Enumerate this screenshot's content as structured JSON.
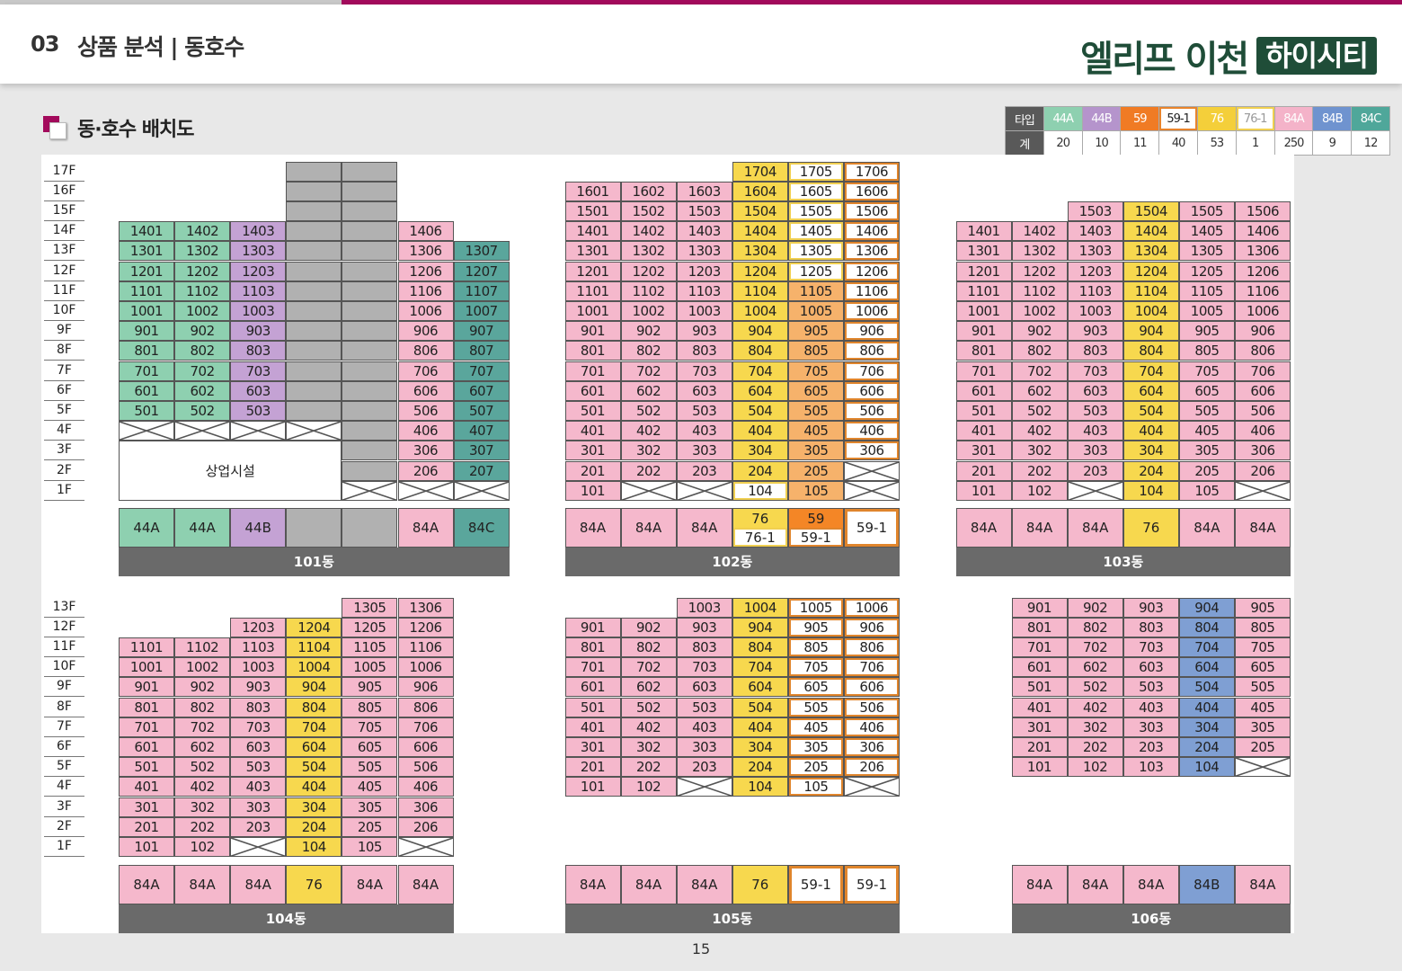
{
  "header": {
    "section_number": "03",
    "section_title": "상품 분석 | 동호수",
    "brand_main": "엘리프 이천",
    "brand_sub": "하이시티"
  },
  "sub_heading": "동·호수 배치도",
  "page_number": "15",
  "colors": {
    "44A": "#8ed0b0",
    "44B": "#c4a2d4",
    "59": "#f48626",
    "59-1": "#ffffff",
    "76": "#f7d84e",
    "76-1": "#ffffff",
    "84A": "#f5b8cc",
    "84B": "#7f9fd3",
    "84C": "#5aa69c",
    "gray": "#b1b1b1",
    "o59": "#f6b26b",
    "outline_59_1": "#e0852c",
    "outline_76_1": "#f0cf50"
  },
  "legend": {
    "row_headers": [
      "타입",
      "계"
    ],
    "types": [
      {
        "name": "44A",
        "count": "20",
        "color": "#8ed0b0",
        "text": "#ffffff",
        "outline": ""
      },
      {
        "name": "44B",
        "count": "10",
        "color": "#b594cc",
        "text": "#ffffff",
        "outline": ""
      },
      {
        "name": "59",
        "count": "11",
        "color": "#f07b24",
        "text": "#ffffff",
        "outline": ""
      },
      {
        "name": "59-1",
        "count": "40",
        "color": "#ffffff",
        "text": "#222222",
        "outline": "#e8842c"
      },
      {
        "name": "76",
        "count": "53",
        "color": "#f4cf3a",
        "text": "#ffffff",
        "outline": ""
      },
      {
        "name": "76-1",
        "count": "1",
        "color": "#ffffff",
        "text": "#999999",
        "outline": "#f0cf50"
      },
      {
        "name": "84A",
        "count": "250",
        "color": "#f4b3c9",
        "text": "#ffffff",
        "outline": ""
      },
      {
        "name": "84B",
        "count": "9",
        "color": "#6f93cf",
        "text": "#ffffff",
        "outline": ""
      },
      {
        "name": "84C",
        "count": "12",
        "color": "#4fa79a",
        "text": "#ffffff",
        "outline": ""
      }
    ]
  },
  "buildings": [
    {
      "name": "101동",
      "floors": [
        "17F",
        "16F",
        "15F",
        "14F",
        "13F",
        "12F",
        "11F",
        "10F",
        "9F",
        "8F",
        "7F",
        "6F",
        "5F",
        "4F",
        "3F",
        "2F",
        "1F"
      ],
      "commercial_label": "상업시설",
      "types": [
        {
          "label": "44A",
          "color": "44A"
        },
        {
          "label": "44A",
          "color": "44A"
        },
        {
          "label": "44B",
          "color": "44B"
        },
        {
          "label": "",
          "color": "gray"
        },
        {
          "label": "",
          "color": "gray"
        },
        {
          "label": "84A",
          "color": "84A"
        },
        {
          "label": "84C",
          "color": "84C"
        }
      ]
    },
    {
      "name": "102동",
      "floors": [],
      "types": [
        {
          "label": "84A",
          "color": "84A"
        },
        {
          "label": "84A",
          "color": "84A"
        },
        {
          "label": "84A",
          "color": "84A"
        },
        {
          "split": [
            "76",
            "76-1"
          ],
          "colors": [
            "76",
            "76-1"
          ]
        },
        {
          "split": [
            "59",
            "59-1"
          ],
          "colors": [
            "59",
            "59-1"
          ]
        },
        {
          "label": "59-1",
          "color": "59-1"
        }
      ]
    },
    {
      "name": "103동",
      "floors": [],
      "types": [
        {
          "label": "84A",
          "color": "84A"
        },
        {
          "label": "84A",
          "color": "84A"
        },
        {
          "label": "84A",
          "color": "84A"
        },
        {
          "label": "76",
          "color": "76"
        },
        {
          "label": "84A",
          "color": "84A"
        },
        {
          "label": "84A",
          "color": "84A"
        }
      ]
    },
    {
      "name": "104동",
      "floors": [
        "13F",
        "12F",
        "11F",
        "10F",
        "9F",
        "8F",
        "7F",
        "6F",
        "5F",
        "4F",
        "3F",
        "2F",
        "1F"
      ],
      "types": [
        {
          "label": "84A",
          "color": "84A"
        },
        {
          "label": "84A",
          "color": "84A"
        },
        {
          "label": "84A",
          "color": "84A"
        },
        {
          "label": "76",
          "color": "76"
        },
        {
          "label": "84A",
          "color": "84A"
        },
        {
          "label": "84A",
          "color": "84A"
        }
      ]
    },
    {
      "name": "105동",
      "floors": [],
      "types": [
        {
          "label": "84A",
          "color": "84A"
        },
        {
          "label": "84A",
          "color": "84A"
        },
        {
          "label": "84A",
          "color": "84A"
        },
        {
          "label": "76",
          "color": "76"
        },
        {
          "label": "59-1",
          "color": "59-1"
        },
        {
          "label": "59-1",
          "color": "59-1"
        }
      ]
    },
    {
      "name": "106동",
      "floors": [],
      "types": [
        {
          "label": "84A",
          "color": "84A"
        },
        {
          "label": "84A",
          "color": "84A"
        },
        {
          "label": "84A",
          "color": "84A"
        },
        {
          "label": "84B",
          "color": "84B"
        },
        {
          "label": "84A",
          "color": "84A"
        }
      ]
    }
  ],
  "units": {
    "b101": [
      [
        "",
        "",
        "",
        "G",
        "G",
        "",
        ""
      ],
      [
        "",
        "",
        "",
        "G",
        "G",
        "",
        ""
      ],
      [
        "",
        "",
        "",
        "G",
        "G",
        "",
        ""
      ],
      [
        "1401:44A",
        "1402:44A",
        "1403:44B",
        "G",
        "G",
        "1406:84A",
        ""
      ],
      [
        "1301:44A",
        "1302:44A",
        "1303:44B",
        "G",
        "G",
        "1306:84A",
        "1307:84C"
      ],
      [
        "1201:44A",
        "1202:44A",
        "1203:44B",
        "G",
        "G",
        "1206:84A",
        "1207:84C"
      ],
      [
        "1101:44A",
        "1102:44A",
        "1103:44B",
        "G",
        "G",
        "1106:84A",
        "1107:84C"
      ],
      [
        "1001:44A",
        "1002:44A",
        "1003:44B",
        "G",
        "G",
        "1006:84A",
        "1007:84C"
      ],
      [
        "901:44A",
        "902:44A",
        "903:44B",
        "G",
        "G",
        "906:84A",
        "907:84C"
      ],
      [
        "801:44A",
        "802:44A",
        "803:44B",
        "G",
        "G",
        "806:84A",
        "807:84C"
      ],
      [
        "701:44A",
        "702:44A",
        "703:44B",
        "G",
        "G",
        "706:84A",
        "707:84C"
      ],
      [
        "601:44A",
        "602:44A",
        "603:44B",
        "G",
        "G",
        "606:84A",
        "607:84C"
      ],
      [
        "501:44A",
        "502:44A",
        "503:44B",
        "G",
        "G",
        "506:84A",
        "507:84C"
      ],
      [
        "X",
        "X",
        "X",
        "X",
        "G",
        "406:84A",
        "407:84C"
      ],
      [
        "C",
        "C",
        "C",
        "C",
        "G",
        "306:84A",
        "307:84C"
      ],
      [
        "C",
        "C",
        "C",
        "C",
        "G",
        "206:84A",
        "207:84C"
      ],
      [
        "C",
        "C",
        "C",
        "C",
        "X",
        "X",
        "X"
      ]
    ],
    "b102": [
      [
        "",
        "",
        "",
        "1704:76",
        "1705:76-1",
        "1706:59-1"
      ],
      [
        "1601:84A",
        "1602:84A",
        "1603:84A",
        "1604:76",
        "1605:76-1",
        "1606:59-1"
      ],
      [
        "1501:84A",
        "1502:84A",
        "1503:84A",
        "1504:76",
        "1505:76-1",
        "1506:59-1"
      ],
      [
        "1401:84A",
        "1402:84A",
        "1403:84A",
        "1404:76",
        "1405:76-1",
        "1406:59-1"
      ],
      [
        "1301:84A",
        "1302:84A",
        "1303:84A",
        "1304:76",
        "1305:76-1",
        "1306:59-1"
      ],
      [
        "1201:84A",
        "1202:84A",
        "1203:84A",
        "1204:76",
        "1205:76-1",
        "1206:59-1"
      ],
      [
        "1101:84A",
        "1102:84A",
        "1103:84A",
        "1104:76",
        "1105:o59",
        "1106:59-1"
      ],
      [
        "1001:84A",
        "1002:84A",
        "1003:84A",
        "1004:76",
        "1005:o59",
        "1006:59-1"
      ],
      [
        "901:84A",
        "902:84A",
        "903:84A",
        "904:76",
        "905:o59",
        "906:59-1"
      ],
      [
        "801:84A",
        "802:84A",
        "803:84A",
        "804:76",
        "805:o59",
        "806:59-1"
      ],
      [
        "701:84A",
        "702:84A",
        "703:84A",
        "704:76",
        "705:o59",
        "706:59-1"
      ],
      [
        "601:84A",
        "602:84A",
        "603:84A",
        "604:76",
        "605:o59",
        "606:59-1"
      ],
      [
        "501:84A",
        "502:84A",
        "503:84A",
        "504:76",
        "505:o59",
        "506:59-1"
      ],
      [
        "401:84A",
        "402:84A",
        "403:84A",
        "404:76",
        "405:o59",
        "406:59-1"
      ],
      [
        "301:84A",
        "302:84A",
        "303:84A",
        "304:76",
        "305:o59",
        "306:59-1"
      ],
      [
        "201:84A",
        "202:84A",
        "203:84A",
        "204:76",
        "205:o59",
        "X"
      ],
      [
        "101:84A",
        "X",
        "X",
        "104:76-1",
        "105:o59",
        "X"
      ]
    ],
    "b103": [
      [
        "",
        "",
        "",
        "",
        "",
        ""
      ],
      [
        "",
        "",
        "",
        "",
        "",
        ""
      ],
      [
        "",
        "",
        "1503:84A",
        "1504:76",
        "1505:84A",
        "1506:84A"
      ],
      [
        "1401:84A",
        "1402:84A",
        "1403:84A",
        "1404:76",
        "1405:84A",
        "1406:84A"
      ],
      [
        "1301:84A",
        "1302:84A",
        "1303:84A",
        "1304:76",
        "1305:84A",
        "1306:84A"
      ],
      [
        "1201:84A",
        "1202:84A",
        "1203:84A",
        "1204:76",
        "1205:84A",
        "1206:84A"
      ],
      [
        "1101:84A",
        "1102:84A",
        "1103:84A",
        "1104:76",
        "1105:84A",
        "1106:84A"
      ],
      [
        "1001:84A",
        "1002:84A",
        "1003:84A",
        "1004:76",
        "1005:84A",
        "1006:84A"
      ],
      [
        "901:84A",
        "902:84A",
        "903:84A",
        "904:76",
        "905:84A",
        "906:84A"
      ],
      [
        "801:84A",
        "802:84A",
        "803:84A",
        "804:76",
        "805:84A",
        "806:84A"
      ],
      [
        "701:84A",
        "702:84A",
        "703:84A",
        "704:76",
        "705:84A",
        "706:84A"
      ],
      [
        "601:84A",
        "602:84A",
        "603:84A",
        "604:76",
        "605:84A",
        "606:84A"
      ],
      [
        "501:84A",
        "502:84A",
        "503:84A",
        "504:76",
        "505:84A",
        "506:84A"
      ],
      [
        "401:84A",
        "402:84A",
        "403:84A",
        "404:76",
        "405:84A",
        "406:84A"
      ],
      [
        "301:84A",
        "302:84A",
        "303:84A",
        "304:76",
        "305:84A",
        "306:84A"
      ],
      [
        "201:84A",
        "202:84A",
        "203:84A",
        "204:76",
        "205:84A",
        "206:84A"
      ],
      [
        "101:84A",
        "102:84A",
        "X",
        "104:76",
        "105:84A",
        "X"
      ]
    ],
    "b104": [
      [
        "",
        "",
        "",
        "",
        "1305:84A",
        "1306:84A"
      ],
      [
        "",
        "",
        "1203:84A",
        "1204:76",
        "1205:84A",
        "1206:84A"
      ],
      [
        "1101:84A",
        "1102:84A",
        "1103:84A",
        "1104:76",
        "1105:84A",
        "1106:84A"
      ],
      [
        "1001:84A",
        "1002:84A",
        "1003:84A",
        "1004:76",
        "1005:84A",
        "1006:84A"
      ],
      [
        "901:84A",
        "902:84A",
        "903:84A",
        "904:76",
        "905:84A",
        "906:84A"
      ],
      [
        "801:84A",
        "802:84A",
        "803:84A",
        "804:76",
        "805:84A",
        "806:84A"
      ],
      [
        "701:84A",
        "702:84A",
        "703:84A",
        "704:76",
        "705:84A",
        "706:84A"
      ],
      [
        "601:84A",
        "602:84A",
        "603:84A",
        "604:76",
        "605:84A",
        "606:84A"
      ],
      [
        "501:84A",
        "502:84A",
        "503:84A",
        "504:76",
        "505:84A",
        "506:84A"
      ],
      [
        "401:84A",
        "402:84A",
        "403:84A",
        "404:76",
        "405:84A",
        "406:84A"
      ],
      [
        "301:84A",
        "302:84A",
        "303:84A",
        "304:76",
        "305:84A",
        "306:84A"
      ],
      [
        "201:84A",
        "202:84A",
        "203:84A",
        "204:76",
        "205:84A",
        "206:84A"
      ],
      [
        "101:84A",
        "102:84A",
        "X",
        "104:76",
        "105:84A",
        "X"
      ]
    ],
    "b105": [
      [
        "",
        "",
        "",
        "",
        "",
        ""
      ],
      [
        "",
        "",
        "",
        "",
        "",
        ""
      ],
      [
        "",
        "",
        "",
        "",
        "",
        ""
      ],
      [
        "",
        "",
        "1003:84A",
        "1004:76",
        "1005:59-1",
        "1006:59-1"
      ],
      [
        "901:84A",
        "902:84A",
        "903:84A",
        "904:76",
        "905:59-1",
        "906:59-1"
      ],
      [
        "801:84A",
        "802:84A",
        "803:84A",
        "804:76",
        "805:59-1",
        "806:59-1"
      ],
      [
        "701:84A",
        "702:84A",
        "703:84A",
        "704:76",
        "705:59-1",
        "706:59-1"
      ],
      [
        "601:84A",
        "602:84A",
        "603:84A",
        "604:76",
        "605:59-1",
        "606:59-1"
      ],
      [
        "501:84A",
        "502:84A",
        "503:84A",
        "504:76",
        "505:59-1",
        "506:59-1"
      ],
      [
        "401:84A",
        "402:84A",
        "403:84A",
        "404:76",
        "405:59-1",
        "406:59-1"
      ],
      [
        "301:84A",
        "302:84A",
        "303:84A",
        "304:76",
        "305:59-1",
        "306:59-1"
      ],
      [
        "201:84A",
        "202:84A",
        "203:84A",
        "204:76",
        "205:59-1",
        "206:59-1"
      ],
      [
        "101:84A",
        "102:84A",
        "X",
        "104:76",
        "105:59-1",
        "X"
      ]
    ],
    "b106": [
      [
        "",
        "",
        "",
        "",
        ""
      ],
      [
        "",
        "",
        "",
        "",
        ""
      ],
      [
        "",
        "",
        "",
        "",
        ""
      ],
      [
        "",
        "",
        "",
        "",
        ""
      ],
      [
        "901:84A",
        "902:84A",
        "903:84A",
        "904:84B",
        "905:84A"
      ],
      [
        "801:84A",
        "802:84A",
        "803:84A",
        "804:84B",
        "805:84A"
      ],
      [
        "701:84A",
        "702:84A",
        "703:84A",
        "704:84B",
        "705:84A"
      ],
      [
        "601:84A",
        "602:84A",
        "603:84A",
        "604:84B",
        "605:84A"
      ],
      [
        "501:84A",
        "502:84A",
        "503:84A",
        "504:84B",
        "505:84A"
      ],
      [
        "401:84A",
        "402:84A",
        "403:84A",
        "404:84B",
        "405:84A"
      ],
      [
        "301:84A",
        "302:84A",
        "303:84A",
        "304:84B",
        "305:84A"
      ],
      [
        "201:84A",
        "202:84A",
        "203:84A",
        "204:84B",
        "205:84A"
      ],
      [
        "101:84A",
        "102:84A",
        "103:84A",
        "104:84B",
        "X"
      ]
    ]
  }
}
